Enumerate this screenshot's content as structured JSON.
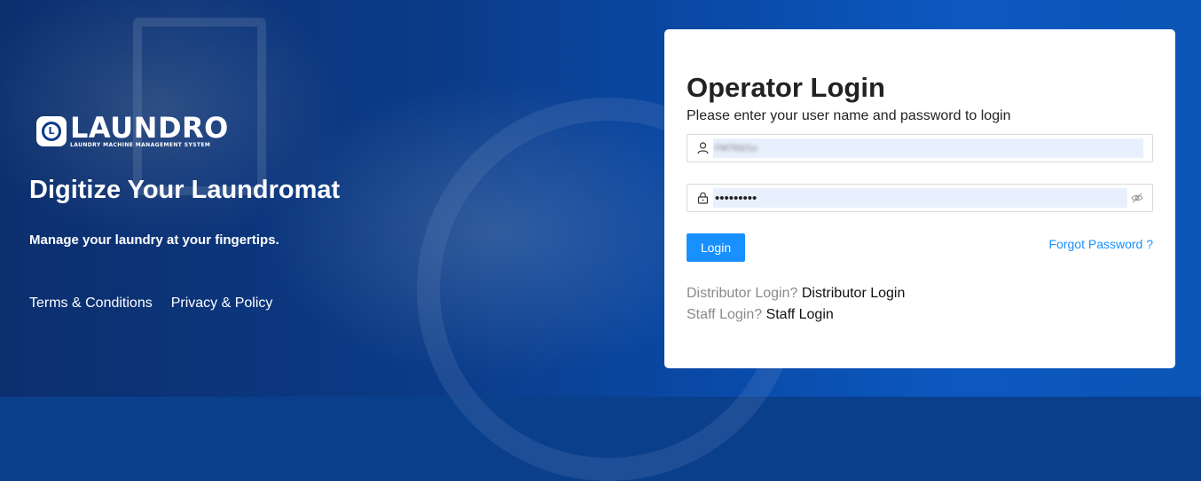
{
  "brand": {
    "logo_mark": "L",
    "logo_word": "LAUNDRO",
    "logo_tagline": "LAUNDRY MACHINE MANAGEMENT SYSTEM"
  },
  "hero": {
    "headline": "Digitize Your Laundromat",
    "tagline": "Manage your laundry at your fingertips.",
    "links": [
      {
        "label": "Terms & Conditions"
      },
      {
        "label": "Privacy & Policy"
      }
    ]
  },
  "login": {
    "title": "Operator Login",
    "subtitle": "Please enter your user name and password to login",
    "username": {
      "value": "FM79321u",
      "icon": "user-icon"
    },
    "password": {
      "value": "•••••••••",
      "icon": "lock-icon",
      "toggle_icon": "eye-invisible-icon"
    },
    "submit_label": "Login",
    "forgot_label": "Forgot Password ?",
    "distributor_prompt": "Distributor Login?",
    "distributor_link": "Distributor Login",
    "staff_prompt": "Staff Login?",
    "staff_link": "Staff Login"
  },
  "colors": {
    "primary": "#1890ff",
    "hero_blue": "#0b3a86",
    "autofill": "#e8f0fe"
  }
}
